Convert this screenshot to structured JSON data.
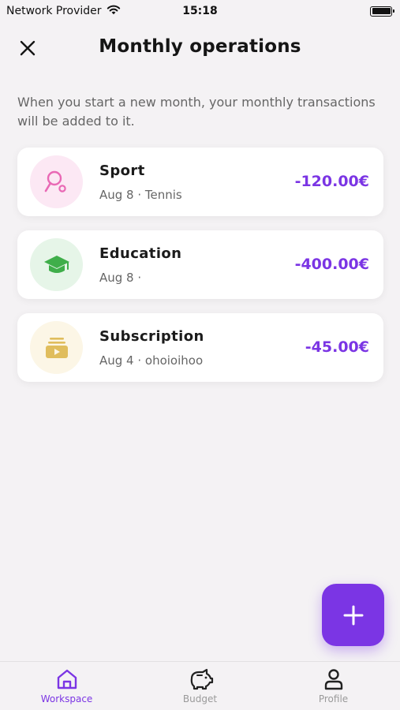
{
  "status_bar": {
    "carrier": "Network Provider",
    "time": "15:18",
    "wifi_icon": "wifi-icon",
    "battery_icon": "battery-icon"
  },
  "header": {
    "title": "Monthly operations",
    "close_icon": "close-icon"
  },
  "description": "When you start a new month, your monthly transactions will be added to it.",
  "operations": [
    {
      "title": "Sport",
      "subtitle": "Aug 8 · Tennis",
      "amount": "-120.00€",
      "icon": "tennis-racket-icon",
      "icon_color": "#e969b5",
      "icon_bg": "#fce8f4"
    },
    {
      "title": "Education",
      "subtitle": "Aug 8 ·",
      "amount": "-400.00€",
      "icon": "graduation-cap-icon",
      "icon_color": "#3fae4a",
      "icon_bg": "#e6f5e8"
    },
    {
      "title": "Subscription",
      "subtitle": "Aug 4 · ohoioihoo",
      "amount": "-45.00€",
      "icon": "subscription-video-icon",
      "icon_color": "#e0bd5d",
      "icon_bg": "#fcf6e6"
    }
  ],
  "fab": {
    "icon": "plus-icon"
  },
  "bottom_nav": [
    {
      "label": "Workspace",
      "icon": "home-icon",
      "active": true
    },
    {
      "label": "Budget",
      "icon": "piggy-bank-icon",
      "active": false
    },
    {
      "label": "Profile",
      "icon": "user-icon",
      "active": false
    }
  ],
  "colors": {
    "accent": "#7b35e4",
    "background": "#f4f2f4",
    "card": "#ffffff",
    "inactive_nav": "#9a9a9a"
  }
}
